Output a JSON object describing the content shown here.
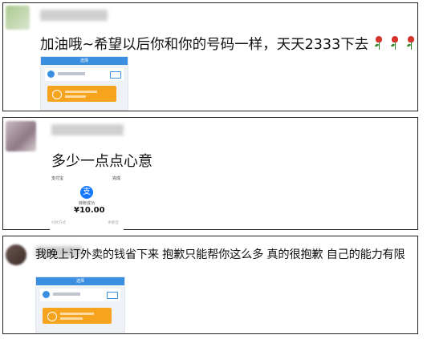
{
  "comments": [
    {
      "text": "加油哦~希望以后你和你的号码一样，天天2333下去",
      "emoji": [
        "rose-icon",
        "rose-icon",
        "rose-icon"
      ],
      "screenshot": {
        "title": "选择",
        "badge": "开"
      }
    },
    {
      "text": "多少一点点心意",
      "screenshot": {
        "top_left": "支付宝",
        "top_right": "完成",
        "status": "转账成功",
        "amount": "¥10.00",
        "meta_left": "付款方式",
        "meta_right": "余额宝"
      }
    },
    {
      "text": "我晚上订外卖的钱省下来 抱歉只能帮你这么多 真的很抱歉 自己的能力有限",
      "screenshot": {
        "title": "选择"
      }
    }
  ]
}
